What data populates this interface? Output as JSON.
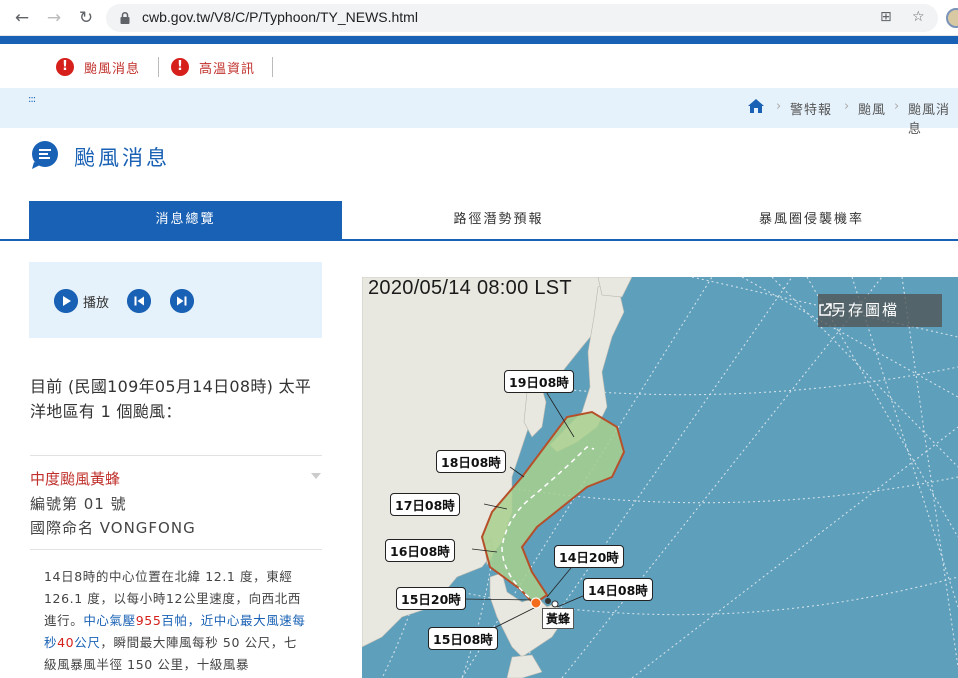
{
  "browser": {
    "url": "cwb.gov.tw/V8/C/P/Typhoon/TY_NEWS.html"
  },
  "alerts": [
    {
      "label": "颱風消息"
    },
    {
      "label": "高溫資訊"
    }
  ],
  "breadcrumb": [
    "警特報",
    "颱風",
    "颱風消息"
  ],
  "page": {
    "title": "颱風消息"
  },
  "tabs": [
    {
      "label": "消息總覽",
      "active": true
    },
    {
      "label": "路徑潛勢預報",
      "active": false
    },
    {
      "label": "暴風圈侵襲機率",
      "active": false
    }
  ],
  "player": {
    "play_label": "播放"
  },
  "current_text": "目前 (民國109年05月14日08時) 太平洋地區有 1 個颱風：",
  "typhoon": {
    "name": "中度颱風黃蜂",
    "number": "編號第 01 號",
    "intl_name": "國際命名 VONGFONG",
    "desc": {
      "p1": "14日8時的中心位置在北緯 12.1 度，東經 126.1 度，以每小時12公里速度，向西北西進行。",
      "p2_a": "中心氣壓",
      "p2_b": "955",
      "p2_c": "百帕",
      "p2_d": "，近中心最大風速每秒",
      "p2_e": "40",
      "p2_f": "公尺",
      "p3": "，瞬間最大陣風每秒 50 公尺，七級風暴風半徑 150 公里，十級風暴"
    }
  },
  "map": {
    "timestamp": "2020/05/14 08:00 LST",
    "save_label": "另存圖檔",
    "typhoon_label": "黃蜂",
    "track_labels": [
      "19日08時",
      "18日08時",
      "17日08時",
      "16日08時",
      "14日20時",
      "14日08時",
      "15日20時",
      "15日08時"
    ],
    "colors": {
      "sea": "#5e9fbc",
      "land": "#e8e8e0",
      "cone": "#a8d08d",
      "cone_edge": "#b5502a",
      "current": "#f36b1c"
    }
  }
}
